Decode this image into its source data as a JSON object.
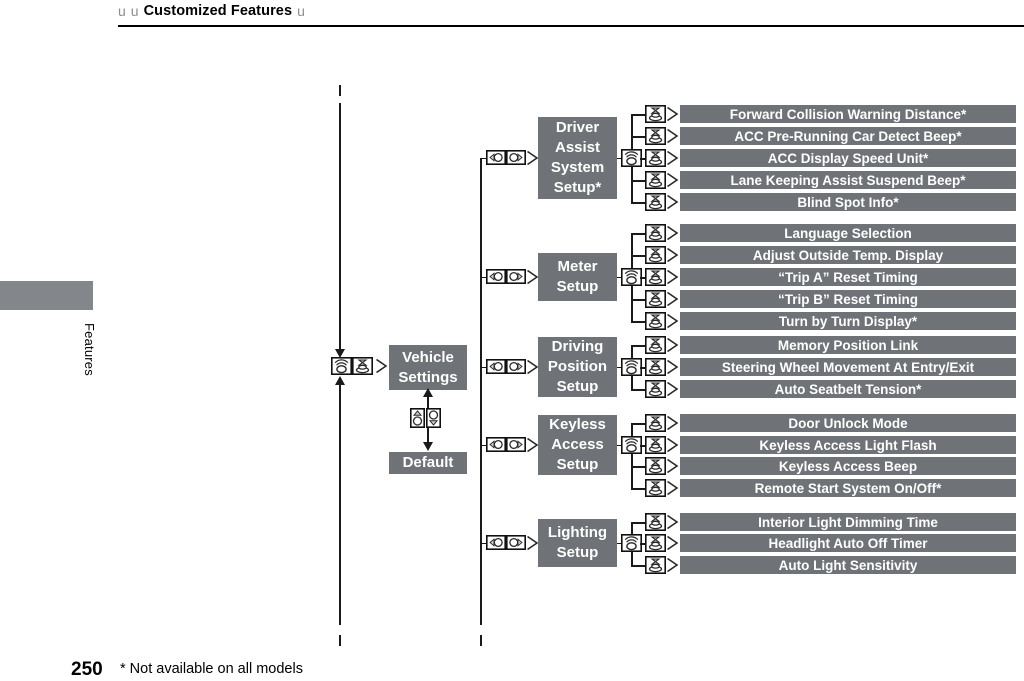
{
  "header": {
    "glyph_a": "u",
    "glyph_b": "u",
    "title": "Customized Features",
    "glyph_c": "u"
  },
  "sidebar": {
    "chapter_label": "Features"
  },
  "footer": {
    "page_number": "250",
    "footnote": "* Not available on all models"
  },
  "colors": {
    "panel_gray": "#6f7276",
    "tab_gray": "#83868b",
    "line_black": "#1a1a1a",
    "label_white": "#ffffff",
    "header_glyph_gray": "#8d8d8d"
  },
  "diagram": {
    "root": {
      "label": "Vehicle Settings",
      "icon_rotate": "knob-rotate-icon",
      "icon_press": "knob-press-icon"
    },
    "default_node": {
      "label": "Default",
      "icon_up": "scroll-up-icon",
      "icon_down": "scroll-down-icon"
    },
    "branch_icons": {
      "turn_left": "knob-turn-left-icon",
      "turn_right": "knob-turn-right-icon",
      "rotate": "knob-rotate-icon",
      "press": "knob-press-icon",
      "arrow": "arrow-right-icon"
    },
    "groups": [
      {
        "label": "Driver Assist System Setup*",
        "items": [
          "Forward Collision Warning Distance*",
          "ACC Pre-Running Car Detect Beep*",
          "ACC Display Speed Unit*",
          "Lane Keeping Assist Suspend Beep*",
          "Blind Spot Info*"
        ]
      },
      {
        "label": "Meter Setup",
        "items": [
          "Language Selection",
          "Adjust Outside Temp. Display",
          "“Trip A” Reset Timing",
          "“Trip B” Reset Timing",
          "Turn by Turn Display*"
        ]
      },
      {
        "label": "Driving Position Setup",
        "items": [
          "Memory Position Link",
          "Steering Wheel Movement At Entry/Exit",
          "Auto Seatbelt Tension*"
        ]
      },
      {
        "label": "Keyless Access Setup",
        "items": [
          "Door Unlock Mode",
          "Keyless Access Light Flash",
          "Keyless Access Beep",
          "Remote Start System On/Off*"
        ]
      },
      {
        "label": "Lighting Setup",
        "items": [
          "Interior Light Dimming Time",
          "Headlight Auto Off Timer",
          "Auto Light Sensitivity"
        ]
      }
    ]
  }
}
